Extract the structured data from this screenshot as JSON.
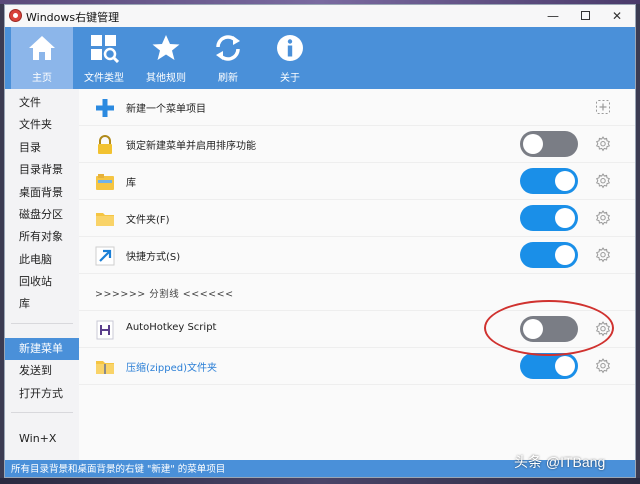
{
  "window": {
    "title": "Windows右键管理",
    "controls": {
      "minimize": "—",
      "close": "✕"
    }
  },
  "toolbar": {
    "buttons": [
      {
        "label": "主页",
        "icon": "home-icon",
        "active": true
      },
      {
        "label": "文件类型",
        "icon": "file-search-icon",
        "active": false
      },
      {
        "label": "其他规则",
        "icon": "star-icon",
        "active": false
      },
      {
        "label": "刷新",
        "icon": "refresh-icon",
        "active": false
      },
      {
        "label": "关于",
        "icon": "info-icon",
        "active": false
      }
    ]
  },
  "sidebar": {
    "items": [
      {
        "label": "文件"
      },
      {
        "label": "文件夹"
      },
      {
        "label": "目录"
      },
      {
        "label": "目录背景"
      },
      {
        "label": "桌面背景"
      },
      {
        "label": "磁盘分区"
      },
      {
        "label": "所有对象"
      },
      {
        "label": "此电脑"
      },
      {
        "label": "回收站"
      },
      {
        "label": "库"
      },
      {
        "label": "新建菜单",
        "active": true
      },
      {
        "label": "发送到"
      },
      {
        "label": "打开方式"
      },
      {
        "label": "Win+X"
      }
    ]
  },
  "content": {
    "rows": [
      {
        "label": "新建一个菜单项目",
        "icon": "plus-icon",
        "kind": "add"
      },
      {
        "label": "锁定新建菜单并启用排序功能",
        "icon": "lock-icon",
        "kind": "toggle",
        "enabled": false
      },
      {
        "label": "库",
        "icon": "library-icon",
        "kind": "toggle",
        "enabled": true
      },
      {
        "label": "文件夹(F)",
        "icon": "folder-icon",
        "kind": "toggle",
        "enabled": true
      },
      {
        "label": "快捷方式(S)",
        "icon": "shortcut-icon",
        "kind": "toggle",
        "enabled": true
      },
      {
        "label": ">>>>>> 分割线 <<<<<<",
        "kind": "separator"
      },
      {
        "label": "AutoHotkey Script",
        "icon": "autohotkey-icon",
        "kind": "toggle",
        "enabled": false
      },
      {
        "label": "压缩(zipped)文件夹",
        "icon": "zip-folder-icon",
        "kind": "toggle",
        "enabled": true,
        "link": true
      }
    ]
  },
  "statusbar": {
    "text": "所有目录背景和桌面背景的右键 \"新建\" 的菜单项目"
  },
  "watermark": "头条 @ITBang",
  "colors": {
    "accent": "#4a90d9",
    "toggle_on": "#1a8fe8",
    "toggle_off": "#7a7d85",
    "annotation": "#d0322f"
  }
}
